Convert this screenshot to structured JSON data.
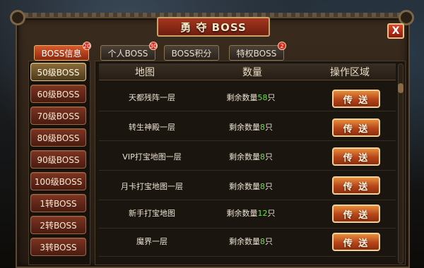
{
  "title": "勇 夺 BOSS",
  "close_label": "X",
  "tabs": [
    {
      "label": "BOSS信息",
      "badge": "20"
    },
    {
      "label": "个人BOSS",
      "badge": "30"
    },
    {
      "label": "BOSS积分",
      "badge": ""
    },
    {
      "label": "特权BOSS",
      "badge": "2"
    }
  ],
  "levels": [
    "50级BOSS",
    "60级BOSS",
    "70级BOSS",
    "80级BOSS",
    "90级BOSS",
    "100级BOSS",
    "1转BOSS",
    "2转BOSS",
    "3转BOSS"
  ],
  "table": {
    "headers": [
      "地图",
      "数量",
      "操作区域"
    ],
    "rows": [
      {
        "map": "天都残阵一层",
        "count_prefix": "剩余数量",
        "count": "58",
        "count_suffix": "只",
        "action": "传 送"
      },
      {
        "map": "转生神殿一层",
        "count_prefix": "剩余数量",
        "count": "8",
        "count_suffix": "只",
        "action": "传 送"
      },
      {
        "map": "VIP打宝地图一层",
        "count_prefix": "剩余数量",
        "count": "8",
        "count_suffix": "只",
        "action": "传 送"
      },
      {
        "map": "月卡打宝地图一层",
        "count_prefix": "剩余数量",
        "count": "8",
        "count_suffix": "只",
        "action": "传 送"
      },
      {
        "map": "新手打宝地图",
        "count_prefix": "剩余数量",
        "count": "12",
        "count_suffix": "只",
        "action": "传 送"
      },
      {
        "map": "魔界一层",
        "count_prefix": "剩余数量",
        "count": "8",
        "count_suffix": "只",
        "action": "传 送"
      }
    ]
  },
  "colors": {
    "accent": "#b6451a",
    "count_number": "#6ae04a"
  }
}
